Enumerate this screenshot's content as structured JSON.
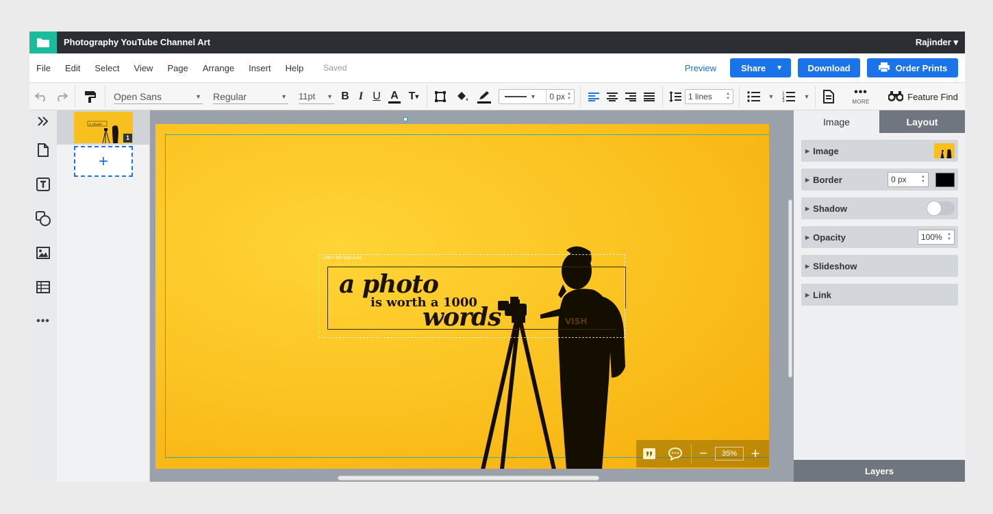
{
  "app": {
    "doc_title": "Photography YouTube Channel Art",
    "user": "Rajinder",
    "accent_color": "#1a73e8",
    "logo_color": "#1abc9c",
    "logo_icon": "folder-icon"
  },
  "menu": {
    "items": [
      "File",
      "Edit",
      "Select",
      "View",
      "Page",
      "Arrange",
      "Insert",
      "Help"
    ],
    "status": "Saved",
    "preview": "Preview",
    "share": "Share",
    "download": "Download",
    "order_prints": "Order Prints"
  },
  "toolbar": {
    "font_family": "Open Sans",
    "font_weight": "Regular",
    "font_size": "11pt",
    "bold": "B",
    "italic": "I",
    "underline": "U",
    "text_color": "A",
    "text_style": "T",
    "border_width": "0 px",
    "line_spacing": "1 lines",
    "more_label": "MORE",
    "feature_find": "Feature Find",
    "icons": [
      "undo-icon",
      "redo-icon",
      "format-painter-icon",
      "bold-icon",
      "italic-icon",
      "underline-icon",
      "text-color-icon",
      "text-style-icon",
      "border-icon",
      "fill-color-icon",
      "stroke-color-icon",
      "align-left-icon",
      "align-center-icon",
      "align-right-icon",
      "justify-icon",
      "line-spacing-icon",
      "bullet-list-icon",
      "numbered-list-icon",
      "page-icon",
      "more-icon",
      "binoculars-icon"
    ]
  },
  "sidebar": {
    "icons": [
      "expand-icon",
      "page-icon",
      "text-icon",
      "shapes-icon",
      "image-icon",
      "table-icon",
      "more-icon"
    ]
  },
  "pages": {
    "thumb_number": "1",
    "add_label": "+"
  },
  "canvas": {
    "safe_area_label": "1280 x 350 Safe Area",
    "headline_line1": "a photo",
    "headline_line2": "is worth a 1000",
    "headline_line3": "words",
    "background_color": "#fbc523",
    "zoom": "35%",
    "zoom_minus": "−",
    "zoom_plus": "+"
  },
  "panel": {
    "tab_image": "Image",
    "tab_layout": "Layout",
    "rows": {
      "image": "Image",
      "border": "Border",
      "border_value": "0 px",
      "border_color": "#000000",
      "shadow": "Shadow",
      "shadow_enabled": false,
      "opacity": "Opacity",
      "opacity_value": "100%",
      "slideshow": "Slideshow",
      "link": "Link"
    },
    "layers": "Layers"
  }
}
